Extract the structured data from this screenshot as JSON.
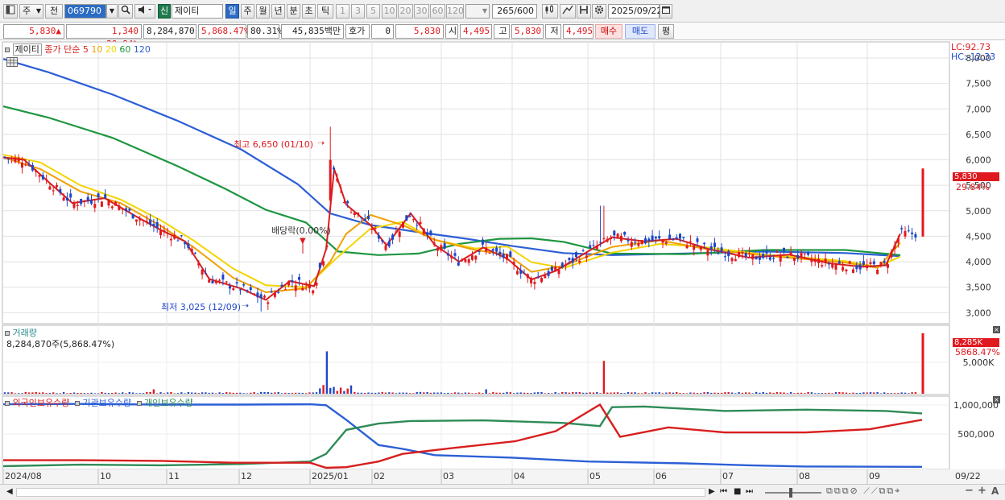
{
  "toolbar": {
    "period_sel": "주",
    "prev_label": "전",
    "code": "069790",
    "new_badge": "신",
    "stock_name": "제이티",
    "tf": [
      "일",
      "주",
      "월",
      "년",
      "분",
      "초",
      "틱"
    ],
    "tf_selected": "일",
    "nums": [
      "1",
      "3",
      "5",
      "10",
      "20",
      "30",
      "60",
      "120"
    ],
    "count": "265",
    "count_total": "/600",
    "date": "2025/09/22"
  },
  "quote": {
    "price": "5,830",
    "arrow": "▲",
    "change": "1,340",
    "change_pct": "+29.84%",
    "volume": "8,284,870",
    "volume_pct": "5,868.47%",
    "rate": "80.31%",
    "amount": "45,835백만",
    "hoga_label": "호가",
    "hoga_val": "0",
    "hoga_price": "5,830",
    "open_label": "시",
    "open": "4,495",
    "high_label": "고",
    "high": "5,830",
    "low_label": "저",
    "low": "4,495",
    "buy": "매수",
    "sell": "매도",
    "eval": "평"
  },
  "price_panel": {
    "name": "제이티",
    "ma_title": "종가 단순",
    "ma": [
      {
        "label": "5",
        "color": "#d81e1e"
      },
      {
        "label": "10",
        "color": "#f0a000"
      },
      {
        "label": "20",
        "color": "#f2d500"
      },
      {
        "label": "60",
        "color": "#1e9640"
      },
      {
        "label": "120",
        "color": "#2c5fd6"
      }
    ],
    "lc": "LC:92.73",
    "hc": "HC:-12.33",
    "last_price_tag": "5,830",
    "last_pct_tag": "29.84%",
    "max_note": "최고 6,650 (01/10)",
    "min_note": "최저 3,025 (12/09)",
    "dividend_note": "배당락(0.00%)"
  },
  "volume_panel": {
    "title": "거래량",
    "value": "8,284,870주(5,868.47%)",
    "tag": "8,285K",
    "tag_pct": "5868.47%",
    "axis": "5,000K"
  },
  "holder_panel": {
    "s1": "외국인보유수량",
    "s2": "기관보유수량",
    "s3": "개인보유수량",
    "axis": [
      "1,000,000",
      "500,000"
    ]
  },
  "xaxis": {
    "labels": [
      "2024/08",
      "10",
      "11",
      "12",
      "2025/01",
      "02",
      "03",
      "04",
      "05",
      "06",
      "07",
      "08",
      "09"
    ],
    "right_label": "09/22"
  },
  "chart_data": [
    {
      "type": "candlestick",
      "title": "제이티",
      "y_ticks": [
        3000,
        3500,
        4000,
        4500,
        5000,
        5500,
        6000,
        6500,
        7000,
        7500,
        8000
      ],
      "ylim": [
        2800,
        8300
      ],
      "x_range": [
        "2024/08",
        "2025/09/22"
      ],
      "last": {
        "date": "2025/09/22",
        "open": 4495,
        "high": 5830,
        "low": 4495,
        "close": 5830,
        "change": 1340,
        "change_pct": 29.84
      },
      "high": {
        "date": "01/10",
        "value": 6650
      },
      "low": {
        "date": "12/09",
        "value": 3025
      },
      "series": [
        {
          "name": "5",
          "color": "#d81e1e"
        },
        {
          "name": "10",
          "color": "#f0a000"
        },
        {
          "name": "20",
          "color": "#f2d500"
        },
        {
          "name": "60",
          "color": "#1e9640"
        },
        {
          "name": "120",
          "color": "#2c5fd6"
        }
      ]
    },
    {
      "type": "bar",
      "title": "거래량",
      "y_ticks": [
        5000000
      ],
      "last": 8284870,
      "spikes": [
        {
          "date": "2025/01",
          "value": 5800000
        },
        {
          "date": "2025/05",
          "value": 4500000
        },
        {
          "date": "2025/09/22",
          "value": 8284870
        }
      ]
    },
    {
      "type": "line",
      "y_ticks": [
        500000,
        1000000
      ],
      "ylim": [
        0,
        1100000
      ],
      "series": [
        {
          "name": "외국인보유수량",
          "color": "#d81e1e"
        },
        {
          "name": "기관보유수량",
          "color": "#2c5fd6"
        },
        {
          "name": "개인보유수량",
          "color": "#2e8b57"
        }
      ]
    }
  ],
  "icons": {
    "toolbar": [
      "chart-settings-icon",
      "search-icon",
      "speaker-icon",
      "candle-icon",
      "crosshair-icon",
      "save-icon",
      "gear-icon",
      "calendar-icon"
    ],
    "bottom": [
      "scroll-left-icon",
      "play-icon",
      "prev-icon",
      "stop-icon",
      "next-icon",
      "zoom-slider-icon",
      "zoom-in-icon",
      "zoom-out-icon"
    ]
  }
}
